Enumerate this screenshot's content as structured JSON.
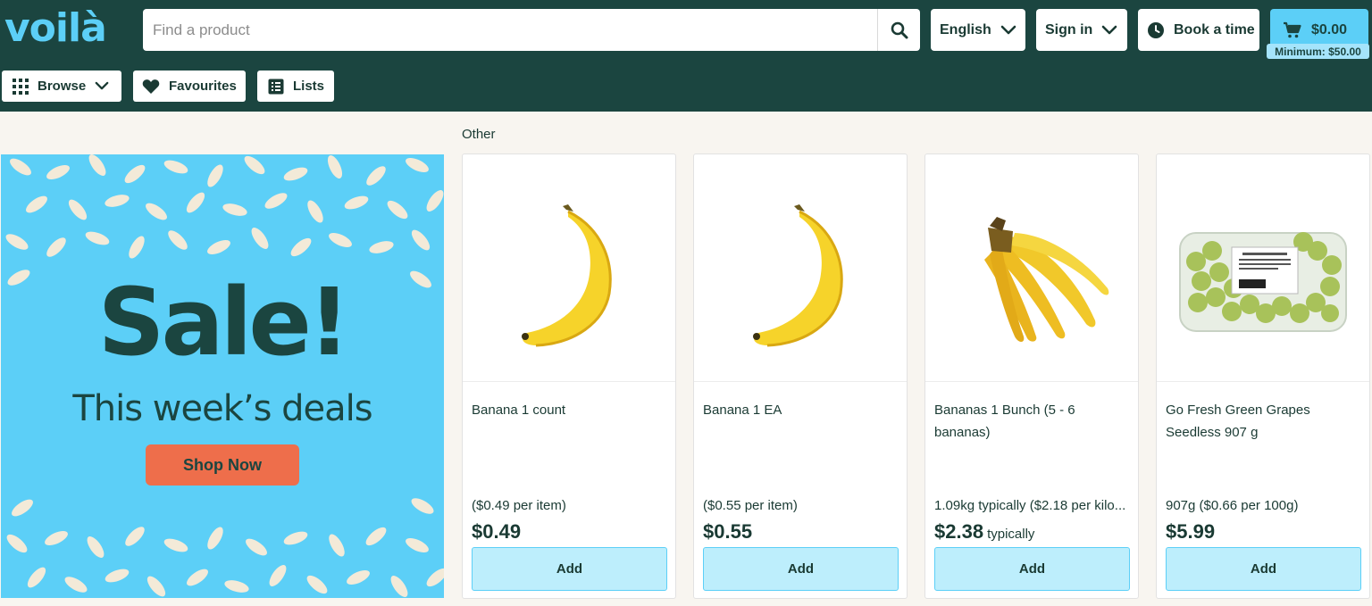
{
  "header": {
    "logo": "voilà",
    "search_placeholder": "Find a product",
    "language_label": "English",
    "signin_label": "Sign in",
    "book_label": "Book a time",
    "cart_amount": "$0.00",
    "cart_minimum": "Minimum: $50.00"
  },
  "nav": {
    "browse_label": "Browse",
    "favourites_label": "Favourites",
    "lists_label": "Lists"
  },
  "banner": {
    "title": "Sale!",
    "subtitle": "This week’s deals",
    "cta_label": "Shop Now"
  },
  "section": {
    "label": "Other"
  },
  "products": [
    {
      "name": "Banana 1 count",
      "unit_price": "($0.49 per item)",
      "price": "$0.49",
      "price_suffix": "",
      "add_label": "Add",
      "image": "single-banana"
    },
    {
      "name": "Banana 1 EA",
      "unit_price": "($0.55 per item)",
      "price": "$0.55",
      "price_suffix": "",
      "add_label": "Add",
      "image": "single-banana"
    },
    {
      "name": "Bananas 1 Bunch (5 - 6 bananas)",
      "unit_price": "1.09kg typically  ($2.18 per kilo...",
      "price": "$2.38",
      "price_suffix": "typically",
      "add_label": "Add",
      "image": "banana-bunch"
    },
    {
      "name": "Go Fresh Green Grapes Seedless 907 g",
      "unit_price": "907g ($0.66 per 100g)",
      "price": "$5.99",
      "price_suffix": "",
      "add_label": "Add",
      "image": "grapes-clamshell"
    }
  ],
  "colors": {
    "header_bg": "#1b4540",
    "brand_blue": "#5ccff7",
    "cta_orange": "#ee6e4b",
    "add_button_bg": "#bdeefc"
  }
}
